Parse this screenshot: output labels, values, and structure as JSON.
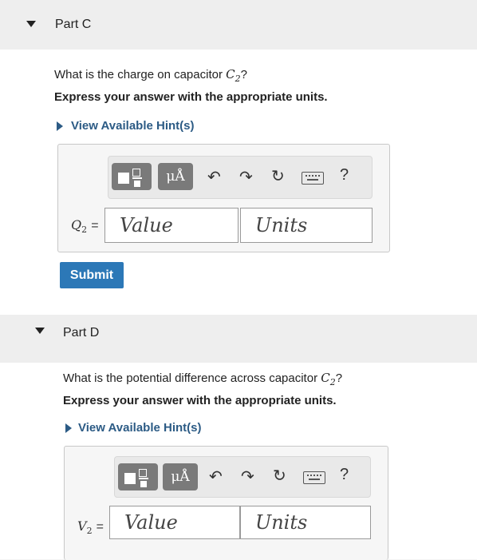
{
  "part_c": {
    "title": "Part C",
    "question_prefix": "What is the charge on capacitor",
    "question_var": "C",
    "question_sub": "2",
    "question_suffix": "?",
    "instruction": "Express your answer with the appropriate units.",
    "hint": "View Available Hint(s)",
    "label_var": "Q",
    "label_sub": "2",
    "label_eq": "=",
    "value_placeholder": "Value",
    "units_placeholder": "Units",
    "submit": "Submit"
  },
  "part_d": {
    "title": "Part D",
    "question_prefix": "What is the potential difference across capacitor",
    "question_var": "C",
    "question_sub": "2",
    "question_suffix": "?",
    "instruction": "Express your answer with the appropriate units.",
    "hint": "View Available Hint(s)",
    "label_var": "V",
    "label_sub": "2",
    "label_eq": "=",
    "value_placeholder": "Value",
    "units_placeholder": "Units"
  },
  "toolbar": {
    "units_symbol": "μÅ",
    "help": "?"
  },
  "colors": {
    "submit": "#2c78b7",
    "hint": "#2c5b85"
  }
}
